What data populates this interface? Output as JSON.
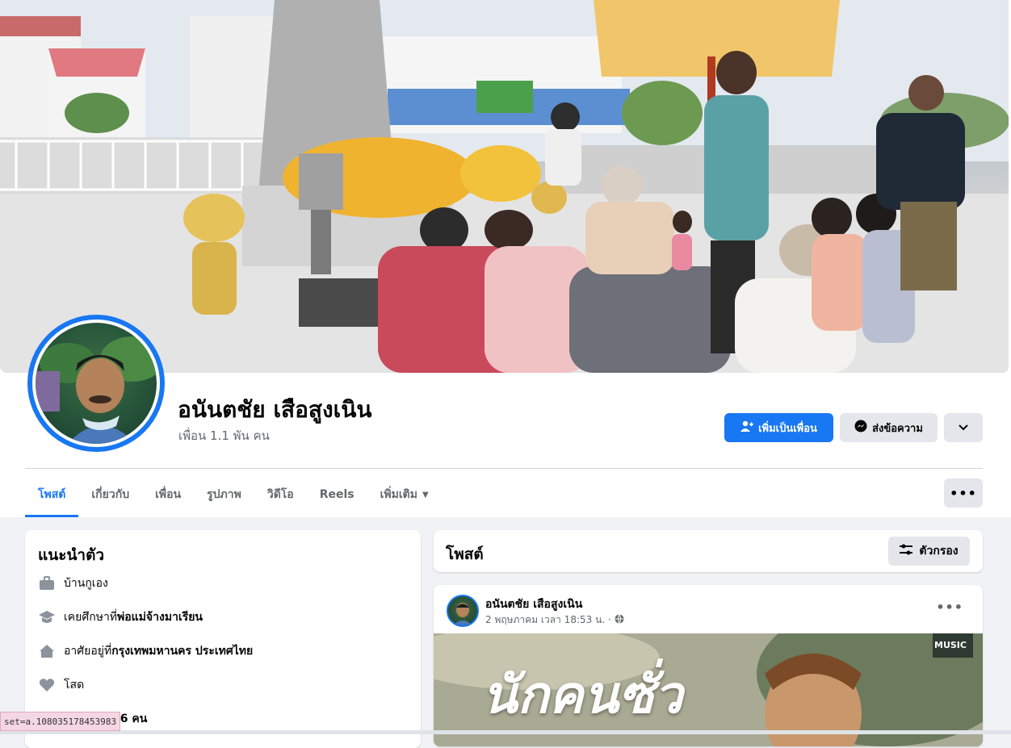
{
  "profile": {
    "name": "อนันตชัย เสือสูงเนิน",
    "friends": "เพื่อน 1.1 พัน คน"
  },
  "actions": {
    "add_friend": "เพิ่มเป็นเพื่อน",
    "message": "ส่งข้อความ",
    "more_icon": "chevron-down-icon"
  },
  "tabs": [
    {
      "label": "โพสต์",
      "active": true
    },
    {
      "label": "เกี่ยวกับ"
    },
    {
      "label": "เพื่อน"
    },
    {
      "label": "รูปภาพ"
    },
    {
      "label": "วิดีโอ"
    },
    {
      "label": "Reels"
    },
    {
      "label": "เพิ่มเติม"
    }
  ],
  "intro": {
    "title": "แนะนำตัว",
    "items": [
      {
        "icon": "briefcase-icon",
        "text": "บ้านกูเอง",
        "bold": ""
      },
      {
        "icon": "graduation-cap-icon",
        "text": "เคยศึกษาที่ ",
        "bold": "พ่อแม่จ้างมาเรียน"
      },
      {
        "icon": "home-icon",
        "text": "อาศัยอยู่ที่ ",
        "bold": "กรุงเทพมหานคร ประเทศไทย"
      },
      {
        "icon": "heart-icon",
        "text": "โสด",
        "bold": ""
      },
      {
        "icon": "followers-icon",
        "text": "",
        "bold": "56 คน"
      }
    ]
  },
  "posts_section": {
    "title": "โพสต์",
    "filter_label": "ตัวกรอง"
  },
  "post": {
    "author": "อนันตชัย เสือสูงเนิน",
    "time": "2 พฤษภาคม เวลา 18:53 น. ·",
    "privacy_icon": "globe-icon",
    "media_text": "นักคนซั่ว",
    "media_logo": "MUSIC"
  },
  "status_url": "set=a.108035178453983",
  "colors": {
    "accent": "#1877f2",
    "background": "#f0f2f5"
  }
}
